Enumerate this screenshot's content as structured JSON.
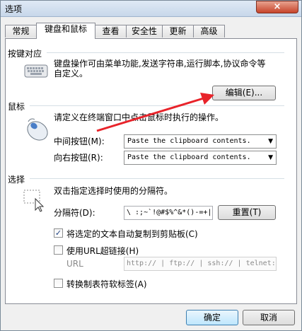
{
  "window": {
    "title": "选项",
    "close_glyph": "×"
  },
  "tabs": [
    "常规",
    "键盘和鼠标",
    "查看",
    "安全性",
    "更新",
    "高级"
  ],
  "keyboard": {
    "title": "按键对应",
    "desc_line1": "键盘操作可由菜单功能,发送字符串,运行脚本,协议命令等",
    "desc_line2": "自定义。",
    "edit_button": "编辑(E)..."
  },
  "mouse": {
    "title": "鼠标",
    "desc": "请定义在终端窗口中点击鼠标时执行的操作。",
    "middle_label": "中间按钮(M):",
    "middle_value": "Paste the clipboard contents.",
    "right_label": "向右按钮(R):",
    "right_value": "Paste the clipboard contents."
  },
  "selection": {
    "title": "选择",
    "desc": "双击指定选择时使用的分隔符。",
    "delim_label": "分隔符(D):",
    "delim_value": "\\ :;~`!@#$%^&*()-=+|",
    "reset_button": "重置(T)",
    "auto_copy_label": "将选定的文本自动复制到剪贴板(C)",
    "auto_copy_checked": true,
    "use_url_label": "使用URL超链接(H)",
    "use_url_checked": false,
    "url_label": "URL",
    "url_value": "http:// | ftp:// | ssh:// | telnet:",
    "tab_label": "转换制表符软标签(A)",
    "tab_checked": false
  },
  "footer": {
    "ok_button": "确定",
    "cancel_button": "取消"
  }
}
